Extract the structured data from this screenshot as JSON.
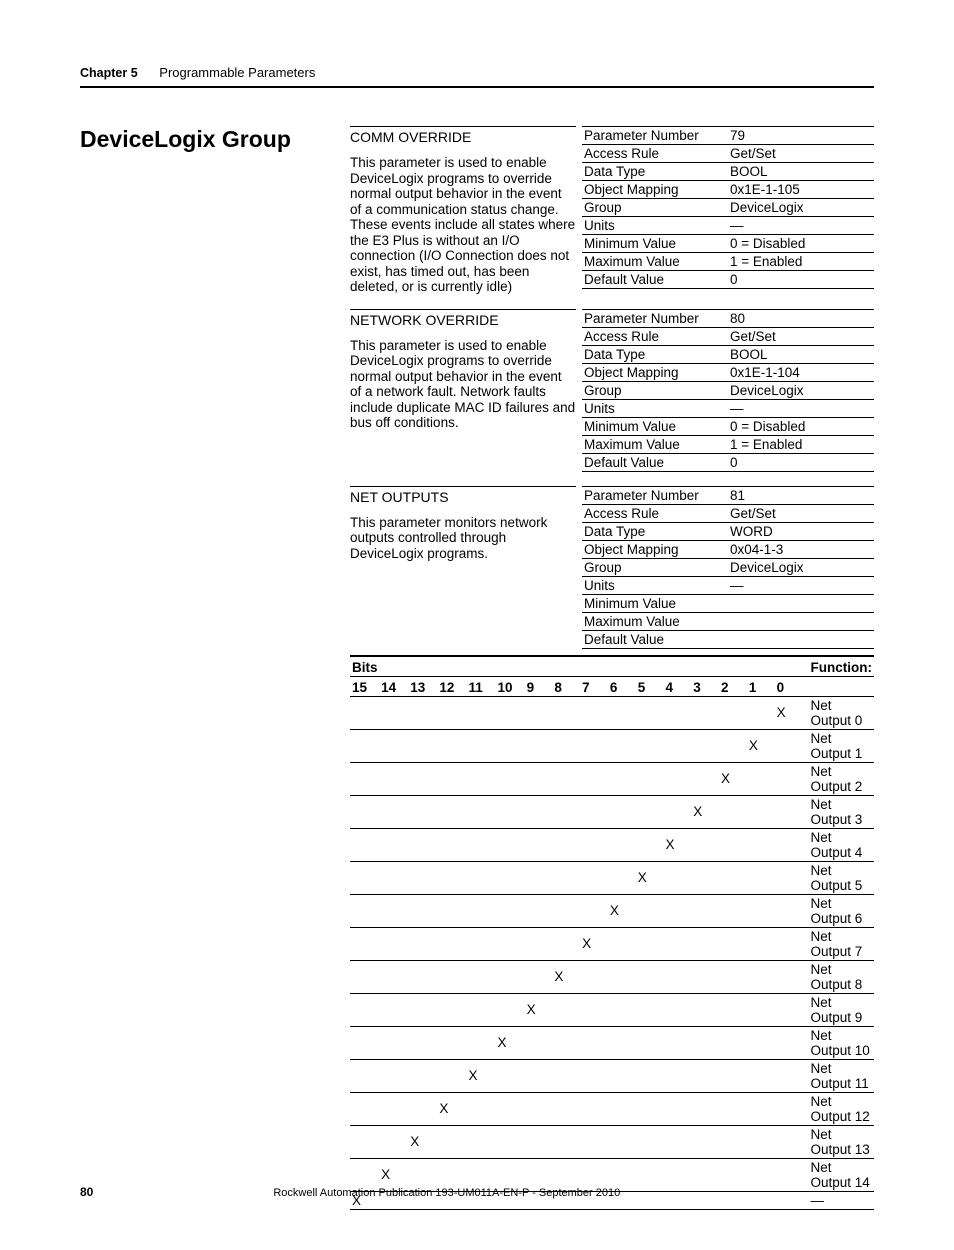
{
  "header": {
    "chapter": "Chapter 5",
    "title": "Programmable Parameters"
  },
  "section_title": "DeviceLogix Group",
  "params": [
    {
      "name": "COMM OVERRIDE",
      "desc": "This parameter is used to enable DeviceLogix programs to override normal output behavior in the event of a communication status change. These events include all states where the E3 Plus is without an I/O connection (I/O Connection does not exist, has timed out, has been deleted, or is currently idle)",
      "attrs": {
        "param_num": "79",
        "access": "Get/Set",
        "dtype": "BOOL",
        "obj_map": "0x1E-1-105",
        "group": "DeviceLogix",
        "units": "—",
        "min": "0 = Disabled",
        "max": "1 = Enabled",
        "def": "0"
      }
    },
    {
      "name": "NETWORK OVERRIDE",
      "desc": "This parameter is used to enable DeviceLogix programs to override normal output behavior in the event of a network fault. Network faults include duplicate MAC ID failures and bus off conditions.",
      "attrs": {
        "param_num": "80",
        "access": "Get/Set",
        "dtype": "BOOL",
        "obj_map": "0x1E-1-104",
        "group": "DeviceLogix",
        "units": "—",
        "min": "0 = Disabled",
        "max": "1 = Enabled",
        "def": "0"
      }
    },
    {
      "name": "NET OUTPUTS",
      "desc": "This parameter monitors network outputs controlled through DeviceLogix programs.",
      "attrs": {
        "param_num": "81",
        "access": "Get/Set",
        "dtype": "WORD",
        "obj_map": "0x04-1-3",
        "group": "DeviceLogix",
        "units": "—",
        "min": "",
        "max": "",
        "def": ""
      }
    }
  ],
  "attr_labels": {
    "param_num": "Parameter Number",
    "access": "Access Rule",
    "dtype": "Data Type",
    "obj_map": "Object Mapping",
    "group": "Group",
    "units": "Units",
    "min": "Minimum Value",
    "max": "Maximum Value",
    "def": "Default Value"
  },
  "bits_header": "Bits",
  "func_header": "Function:",
  "bit_columns": [
    "15",
    "14",
    "13",
    "12",
    "11",
    "10",
    "9",
    "8",
    "7",
    "6",
    "5",
    "4",
    "3",
    "2",
    "1",
    "0"
  ],
  "bit_rows": [
    {
      "mark_col": "0",
      "func": "Net Output 0"
    },
    {
      "mark_col": "1",
      "func": "Net Output 1"
    },
    {
      "mark_col": "2",
      "func": "Net Output 2"
    },
    {
      "mark_col": "3",
      "func": "Net Output 3"
    },
    {
      "mark_col": "4",
      "func": "Net Output 4"
    },
    {
      "mark_col": "5",
      "func": "Net Output 5"
    },
    {
      "mark_col": "6",
      "func": "Net Output 6"
    },
    {
      "mark_col": "7",
      "func": "Net Output 7"
    },
    {
      "mark_col": "8",
      "func": "Net Output 8"
    },
    {
      "mark_col": "9",
      "func": "Net Output 9"
    },
    {
      "mark_col": "10",
      "func": "Net Output 10"
    },
    {
      "mark_col": "11",
      "func": "Net Output 11"
    },
    {
      "mark_col": "12",
      "func": "Net Output 12"
    },
    {
      "mark_col": "13",
      "func": "Net Output 13"
    },
    {
      "mark_col": "14",
      "func": "Net Output 14"
    },
    {
      "mark_col": "15",
      "func": "—"
    }
  ],
  "footer": {
    "page": "80",
    "pub": "Rockwell Automation Publication 193-UM011A-EN-P - September 2010"
  }
}
